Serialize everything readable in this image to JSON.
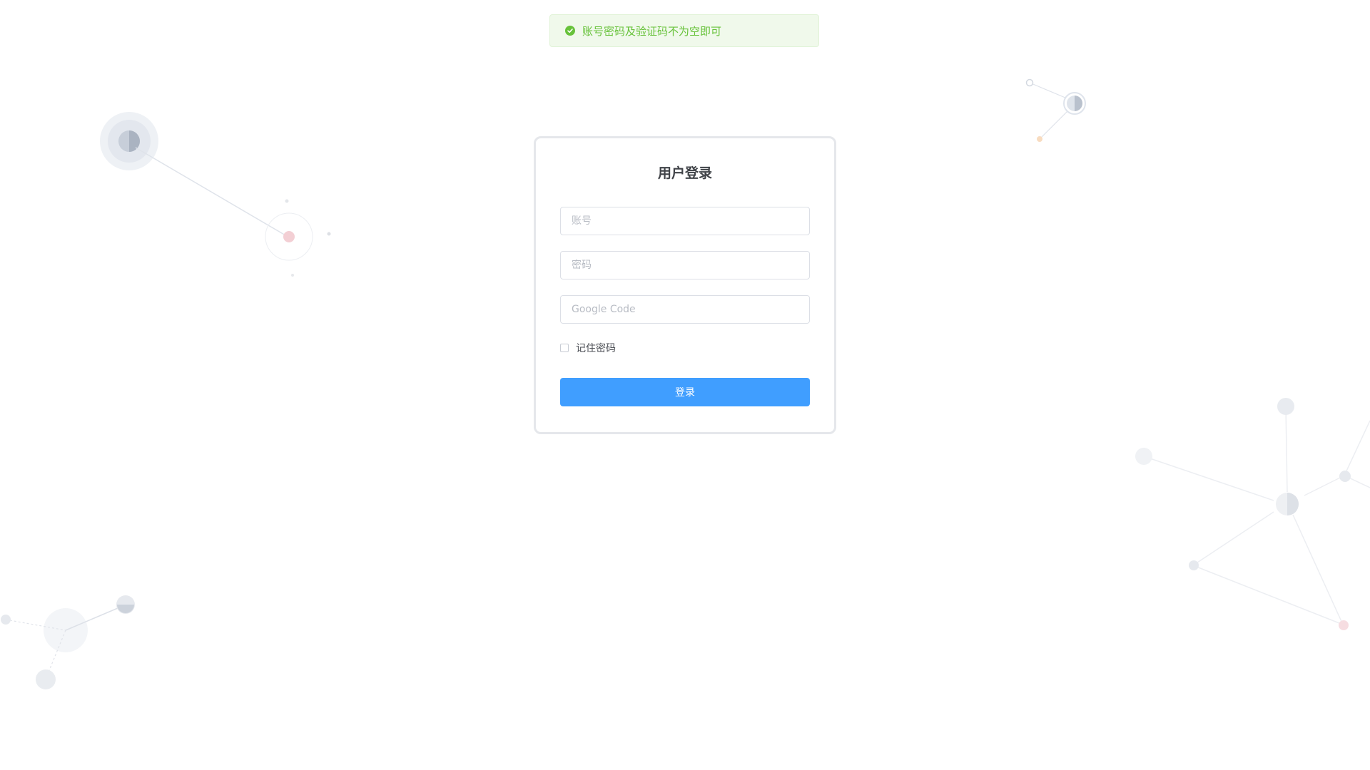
{
  "toast": {
    "icon": "check-circle-icon",
    "message": "账号密码及验证码不为空即可",
    "color": "#67c23a"
  },
  "login": {
    "title": "用户登录",
    "account_placeholder": "账号",
    "password_placeholder": "密码",
    "google_code_placeholder": "Google Code",
    "remember_label": "记住密码",
    "submit_label": "登录"
  },
  "colors": {
    "primary": "#409eff",
    "success": "#67c23a",
    "border": "#dcdfe6"
  }
}
